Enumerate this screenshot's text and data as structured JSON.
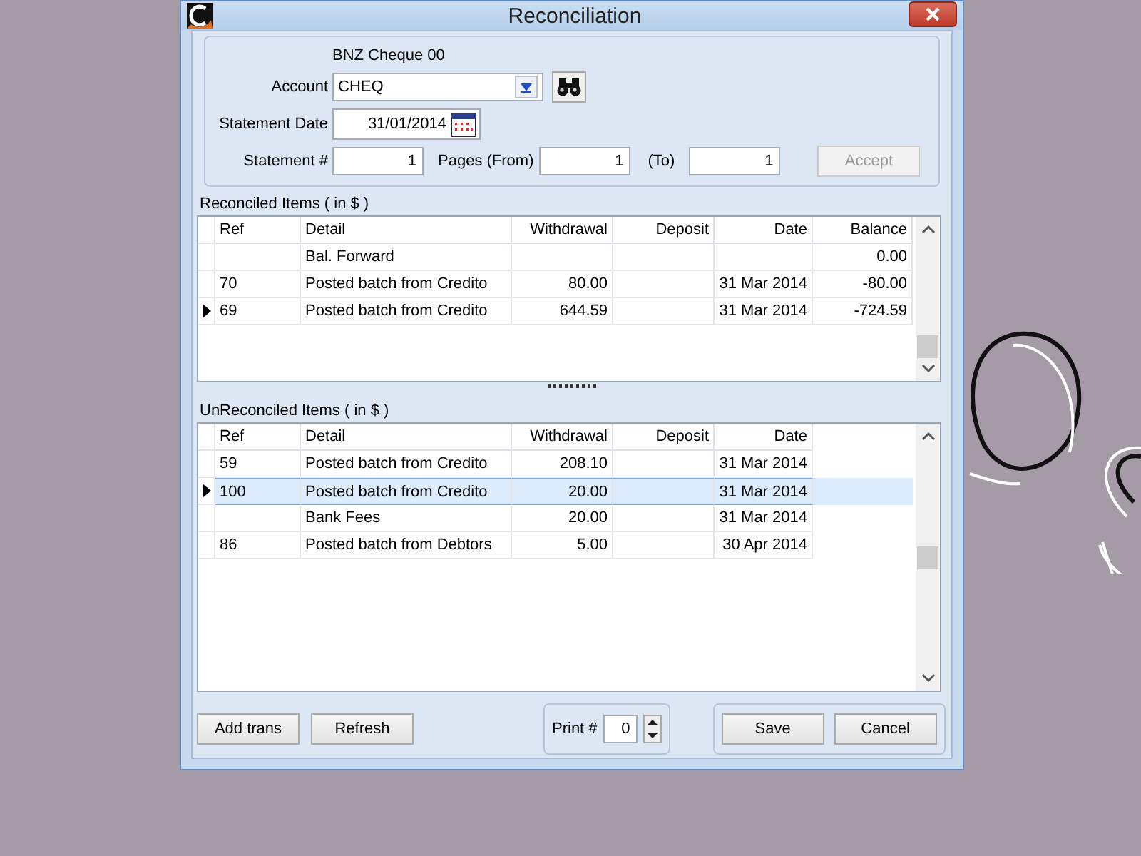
{
  "window": {
    "title": "Reconciliation"
  },
  "header": {
    "bank_name": "BNZ Cheque 00",
    "account_label": "Account",
    "account_value": "CHEQ",
    "date_label": "Statement Date",
    "date_value": "31/01/2014",
    "statement_label": "Statement #",
    "statement_value": "1",
    "pages_from_label": "Pages (From)",
    "pages_from_value": "1",
    "pages_to_label": "(To)",
    "pages_to_value": "1",
    "accept_button": {
      "label": "Accept",
      "disabled": true
    }
  },
  "reconciled": {
    "title": "Reconciled Items ( in $ )",
    "columns": [
      "Ref",
      "Detail",
      "Withdrawal",
      "Deposit",
      "Date",
      "Balance"
    ],
    "rows": [
      {
        "cells": [
          "",
          "Bal. Forward",
          "",
          "",
          "",
          "0.00"
        ],
        "current": false,
        "selected": false
      },
      {
        "cells": [
          "70",
          "Posted batch from Credito",
          "80.00",
          "",
          "31 Mar 2014",
          "-80.00"
        ],
        "current": false,
        "selected": false
      },
      {
        "cells": [
          "69",
          "Posted batch from Credito",
          "644.59",
          "",
          "31 Mar 2014",
          "-724.59"
        ],
        "current": true,
        "selected": false
      }
    ]
  },
  "unreconciled": {
    "title": "UnReconciled Items ( in $ )",
    "columns": [
      "Ref",
      "Detail",
      "Withdrawal",
      "Deposit",
      "Date"
    ],
    "rows": [
      {
        "cells": [
          "59",
          "Posted batch from Credito",
          "208.10",
          "",
          "31 Mar 2014"
        ],
        "current": false,
        "selected": false
      },
      {
        "cells": [
          "100",
          "Posted batch from Credito",
          "20.00",
          "",
          "31 Mar 2014"
        ],
        "current": true,
        "selected": true
      },
      {
        "cells": [
          "",
          "Bank Fees",
          "20.00",
          "",
          "31 Mar 2014"
        ],
        "current": false,
        "selected": false
      },
      {
        "cells": [
          "86",
          "Posted batch from Debtors",
          "5.00",
          "",
          "30 Apr 2014"
        ],
        "current": false,
        "selected": false
      }
    ]
  },
  "footer": {
    "add_button": "Add trans",
    "refresh_button": "Refresh",
    "print_label": "Print #",
    "print_value": "0",
    "save_button": "Save",
    "cancel_button": "Cancel"
  }
}
